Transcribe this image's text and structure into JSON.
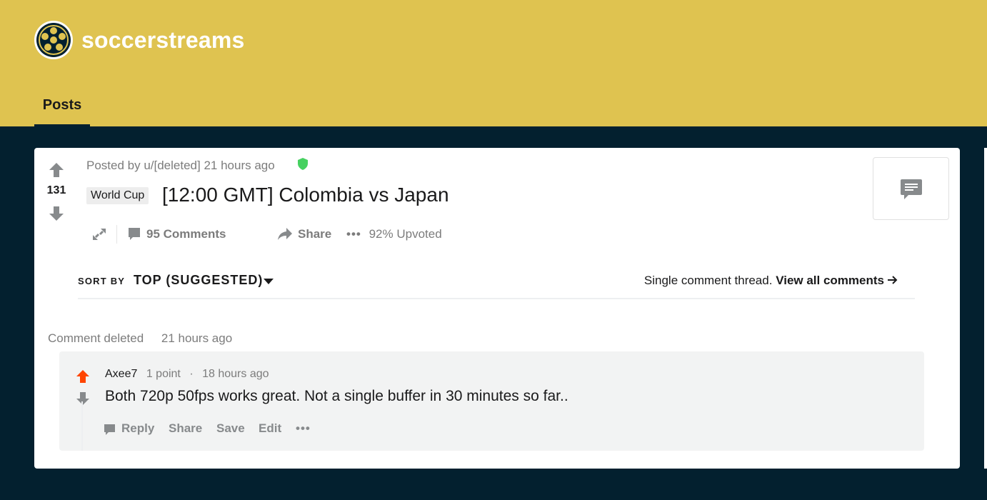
{
  "colors": {
    "banner": "#dfc350",
    "page_background": "#03202f",
    "upvote_active": "#ff4500",
    "mod_shield": "#46d160"
  },
  "header": {
    "subreddit_name": "soccerstreams",
    "logo_icon": "soccer-ball-icon",
    "tabs": [
      {
        "label": "Posts",
        "active": true
      }
    ]
  },
  "post": {
    "score": "131",
    "meta": "Posted by u/[deleted] 21 hours ago",
    "flair": "World Cup",
    "title": "[12:00 GMT] Colombia vs Japan",
    "actions": {
      "comments": "95 Comments",
      "share": "Share",
      "upvoted": "92% Upvoted"
    }
  },
  "sort": {
    "label": "SORT BY",
    "value": "TOP (SUGGESTED)",
    "thread_note": "Single comment thread.",
    "view_all": "View all comments"
  },
  "comments": {
    "deleted": {
      "label": "Comment deleted",
      "time": "21 hours ago"
    },
    "reply": {
      "author": "Axee7",
      "points": "1 point",
      "separator": "·",
      "time": "18 hours ago",
      "body": "Both 720p 50fps works great. Not a single buffer in 30 minutes so far..",
      "actions": {
        "reply": "Reply",
        "share": "Share",
        "save": "Save",
        "edit": "Edit",
        "more": "•••"
      }
    }
  }
}
